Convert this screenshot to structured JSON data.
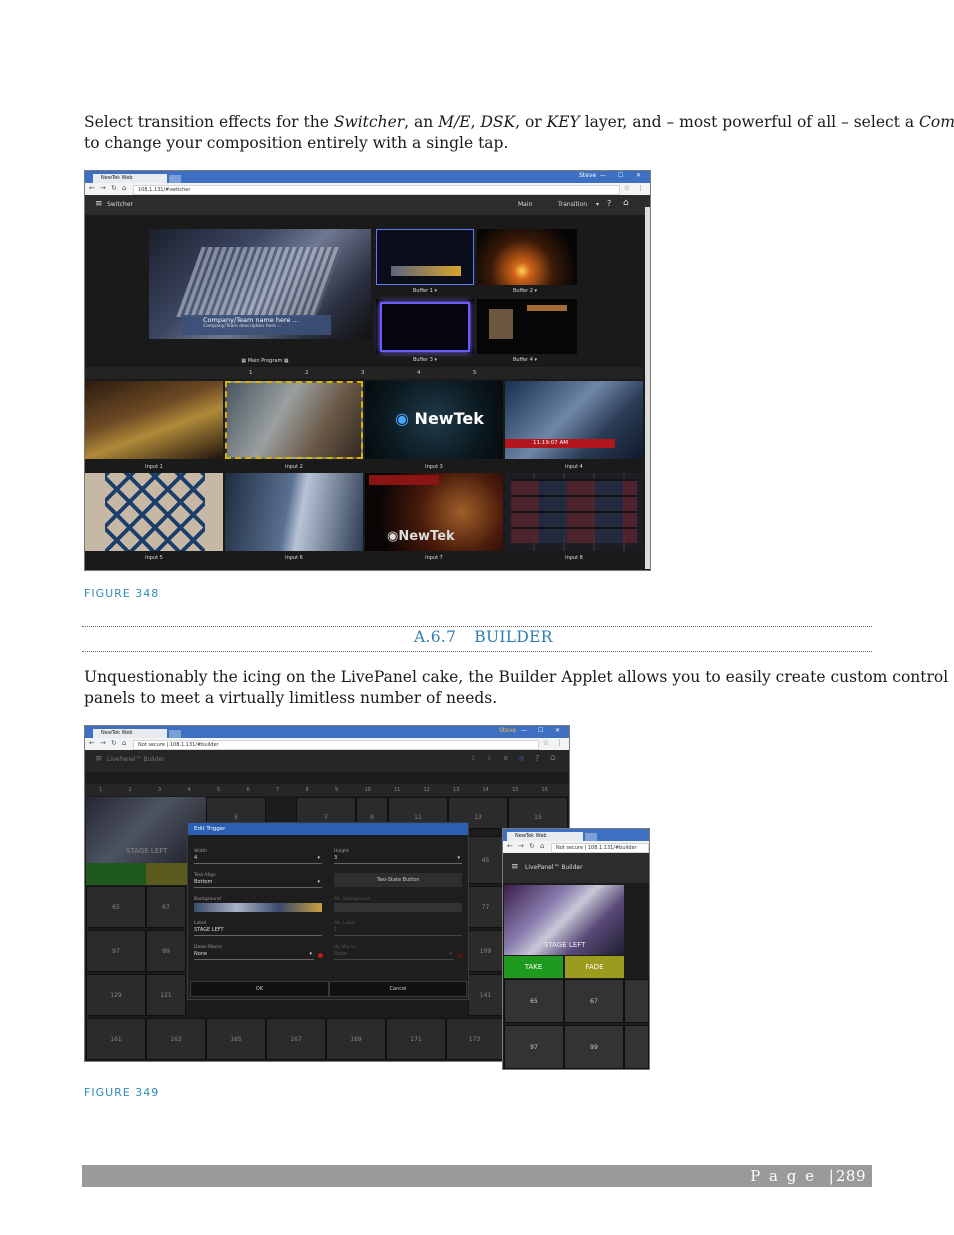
{
  "intro": {
    "before_switcher": "Select transition effects for the ",
    "switcher": "Switcher",
    "after_switcher": ", an ",
    "me": "M/E",
    "comma1": ", ",
    "dsk": "DSK",
    "comma2": ", or ",
    "key": "KEY",
    "after_key": " layer, and – most powerful of all – select a ",
    "comp": "Comp",
    "line2": "to change your composition entirely with a single tap."
  },
  "fig348": {
    "caption": "FIGURE 348",
    "browser": {
      "tab_title": "NewTek Web",
      "user": "Steve",
      "url": "108.1.131/#switcher",
      "app_title": "Switcher",
      "main_label": "Main",
      "transition_label": "Transition"
    },
    "buffers": [
      "Buffer 1",
      "Buffer 2",
      "Buffer 3",
      "Buffer 4"
    ],
    "main_program": "Main Program",
    "lower_third_name": "Company/Team name here ...",
    "lower_third_desc": "Company/Team description here ...",
    "page_numbers": [
      "1",
      "2",
      "3",
      "4",
      "5"
    ],
    "inputs": [
      "Input 1",
      "Input 2",
      "Input 3",
      "Input 4",
      "Input 5",
      "Input 6",
      "Input 7",
      "Input 8"
    ],
    "input3_logo": "NewTek",
    "input4_time": "11:19:07 AM",
    "input7_logo": "NewTek"
  },
  "section": {
    "number": "A.6.7",
    "title": "BUILDER"
  },
  "builder_para": {
    "line1": "Unquestionably the icing on the LivePanel cake, the Builder Applet allows you to easily create custom control",
    "line2": "panels to meet a virtually limitless number of needs."
  },
  "fig349": {
    "caption": "FIGURE 349",
    "browser": {
      "tab_title": "NewTek Web",
      "user": "Steve",
      "url_prefix": "Not secure",
      "url": "108.1.131/#builder",
      "app_title": "LivePanel™ Builder"
    },
    "columns": [
      "1",
      "2",
      "3",
      "4",
      "5",
      "6",
      "7",
      "8",
      "9",
      "10",
      "11",
      "12",
      "13",
      "14",
      "15",
      "16"
    ],
    "row1_numbers": [
      "5",
      "7",
      "9",
      "11",
      "13",
      "15"
    ],
    "side_numbers": [
      "45",
      "77",
      "109",
      "141"
    ],
    "left_numbers": [
      "65",
      "67",
      "97",
      "99",
      "129",
      "121"
    ],
    "bottom_numbers": [
      "161",
      "163",
      "165",
      "167",
      "169",
      "171",
      "173"
    ],
    "stage_left": "STAGE LEFT",
    "dialog": {
      "title": "Edit Trigger",
      "width_label": "Width",
      "width_value": "4",
      "height_label": "Height",
      "height_value": "3",
      "text_align_label": "Text Align",
      "text_align_value": "Bottom",
      "two_state": "Two-State Button",
      "background_label": "Background",
      "alt_background_label": "Alt. Background",
      "label_label": "Label",
      "label_value": "STAGE LEFT",
      "alt_label_label": "Alt. Label",
      "alt_label_value": "1",
      "down_macro_label": "Down Macro",
      "down_macro_value": "None",
      "up_macro_label": "Up Macro",
      "up_macro_value": "None",
      "ok": "OK",
      "cancel": "Cancel"
    },
    "mobile": {
      "tab_title": "NewTek Web",
      "url_prefix": "Not secure",
      "url": "108.1.131/#builder",
      "app_title": "LivePanel™ Builder",
      "stage_left": "STAGE LEFT",
      "take": "TAKE",
      "fade": "FADE",
      "numbers": [
        "65",
        "67",
        "97",
        "99"
      ]
    },
    "colors": {
      "take": "#1e9b1e",
      "fade": "#9b9b1e"
    }
  },
  "footer": {
    "page_label": "P a g e",
    "separator": "|",
    "page_number": "289"
  }
}
